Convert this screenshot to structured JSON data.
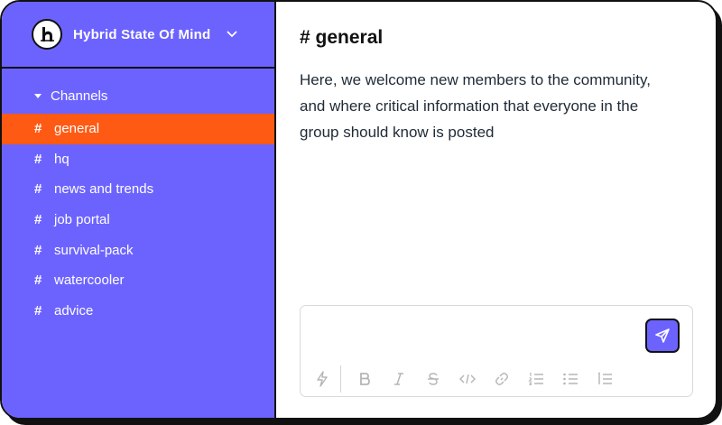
{
  "workspace": {
    "name": "Hybrid State Of Mind",
    "logo_letter": "h"
  },
  "sidebar": {
    "section_label": "Channels",
    "hash_glyph": "#",
    "channels": [
      {
        "label": "general",
        "active": true
      },
      {
        "label": "hq",
        "active": false
      },
      {
        "label": "news and trends",
        "active": false
      },
      {
        "label": "job portal",
        "active": false
      },
      {
        "label": "survival-pack",
        "active": false
      },
      {
        "label": "watercooler",
        "active": false
      },
      {
        "label": "advice",
        "active": false
      }
    ]
  },
  "main": {
    "title": "# general",
    "description": "Here, we welcome new members to the community, and where critical information that everyone in the group should know is posted"
  },
  "composer": {
    "message_value": "",
    "toolbar_icons": [
      "lightning-icon",
      "bold-icon",
      "italic-icon",
      "strikethrough-icon",
      "code-icon",
      "link-icon",
      "ordered-list-icon",
      "bullet-list-icon",
      "numbered-list-icon"
    ]
  },
  "colors": {
    "sidebar_bg": "#6c63ff",
    "active_channel_bg": "#ff5a14",
    "send_button_bg": "#6c63ff",
    "border": "#111111"
  }
}
